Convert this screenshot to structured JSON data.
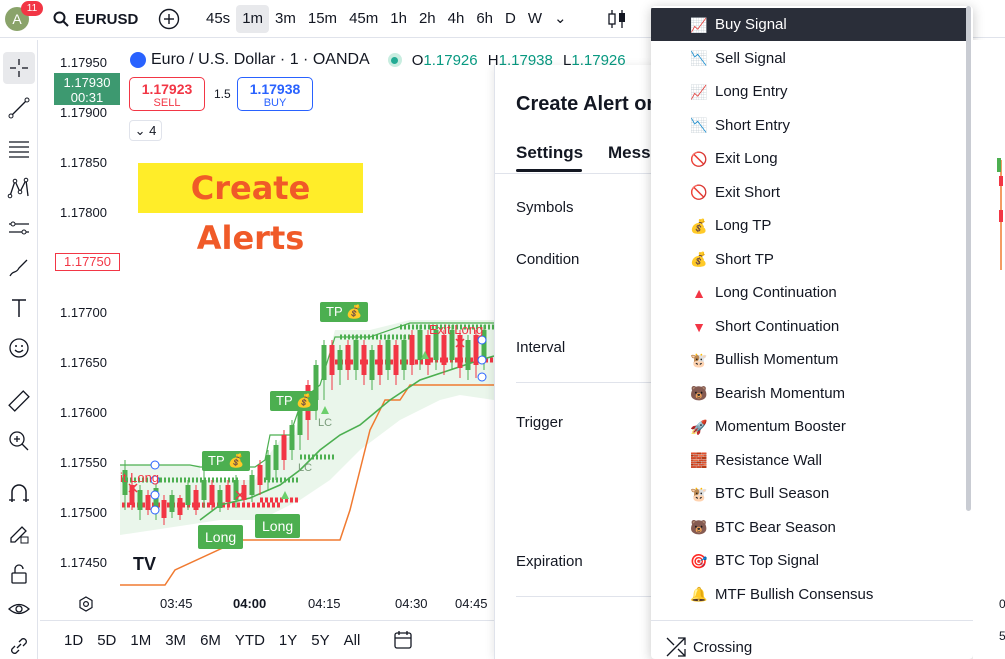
{
  "topbar": {
    "avatar_letter": "A",
    "notification_count": "11",
    "symbol": "EURUSD",
    "intervals": [
      "45s",
      "1m",
      "3m",
      "15m",
      "45m",
      "1h",
      "2h",
      "4h",
      "6h",
      "D",
      "W"
    ],
    "active_interval": "1m"
  },
  "chart": {
    "title": "Euro / U.S. Dollar · 1 · OANDA",
    "ohlc": {
      "o_label": "O",
      "o": "1.17926",
      "h_label": "H",
      "h": "1.17938",
      "l_label": "L",
      "l": "1.17926"
    },
    "current_price": "1.17930",
    "countdown": "00:31",
    "sell_price": "1.17923",
    "sell_label": "SELL",
    "buy_price": "1.17938",
    "buy_label": "BUY",
    "spread": "1.5",
    "indicator_count": "4",
    "promo_text": "Create Alerts",
    "y_labels": [
      "1.17950",
      "1.17900",
      "1.17850",
      "1.17800",
      "1.17700",
      "1.17650",
      "1.17600",
      "1.17550",
      "1.17500",
      "1.17450"
    ],
    "alert_line_price": "1.17750",
    "x_labels": [
      "03:45",
      "04:00",
      "04:15",
      "04:30",
      "04:45"
    ],
    "tp_label": "TP 💰",
    "long_label": "Long",
    "exit_long_label": "Exit Long",
    "exit_long_cut": "it Long",
    "lc_label": "LC",
    "watermark": "TV",
    "colors": {
      "up": "#4caf50",
      "down": "#f23645",
      "band": "#e8f5e9",
      "orange": "#f07a30"
    }
  },
  "bottombar": {
    "ranges": [
      "1D",
      "5D",
      "1M",
      "3M",
      "6M",
      "YTD",
      "1Y",
      "5Y",
      "All"
    ]
  },
  "dialog": {
    "title": "Create Alert or",
    "tabs": [
      "Settings",
      "Messa"
    ],
    "fields": [
      "Symbols",
      "Condition",
      "Interval",
      "Trigger",
      "Expiration"
    ]
  },
  "dropdown": {
    "items": [
      {
        "icon": "📈",
        "label": "Buy Signal",
        "selected": true
      },
      {
        "icon": "📉",
        "label": "Sell Signal"
      },
      {
        "icon": "📈",
        "label": "Long Entry"
      },
      {
        "icon": "📉",
        "label": "Short Entry"
      },
      {
        "icon": "🚫",
        "label": "Exit Long"
      },
      {
        "icon": "🚫",
        "label": "Exit Short"
      },
      {
        "icon": "💰",
        "label": "Long TP"
      },
      {
        "icon": "💰",
        "label": "Short TP"
      },
      {
        "icon": "▲",
        "label": "Long Continuation"
      },
      {
        "icon": "▼",
        "label": "Short Continuation"
      },
      {
        "icon": "🐮",
        "label": "Bullish Momentum"
      },
      {
        "icon": "🐻",
        "label": "Bearish Momentum"
      },
      {
        "icon": "🚀",
        "label": "Momentum Booster"
      },
      {
        "icon": "🧱",
        "label": "Resistance Wall"
      },
      {
        "icon": "🐮",
        "label": "BTC Bull Season"
      },
      {
        "icon": "🐻",
        "label": "BTC Bear Season"
      },
      {
        "icon": "🎯",
        "label": "BTC Top Signal"
      },
      {
        "icon": "🔔",
        "label": "MTF Bullish Consensus"
      }
    ],
    "footer_label": "Crossing"
  }
}
